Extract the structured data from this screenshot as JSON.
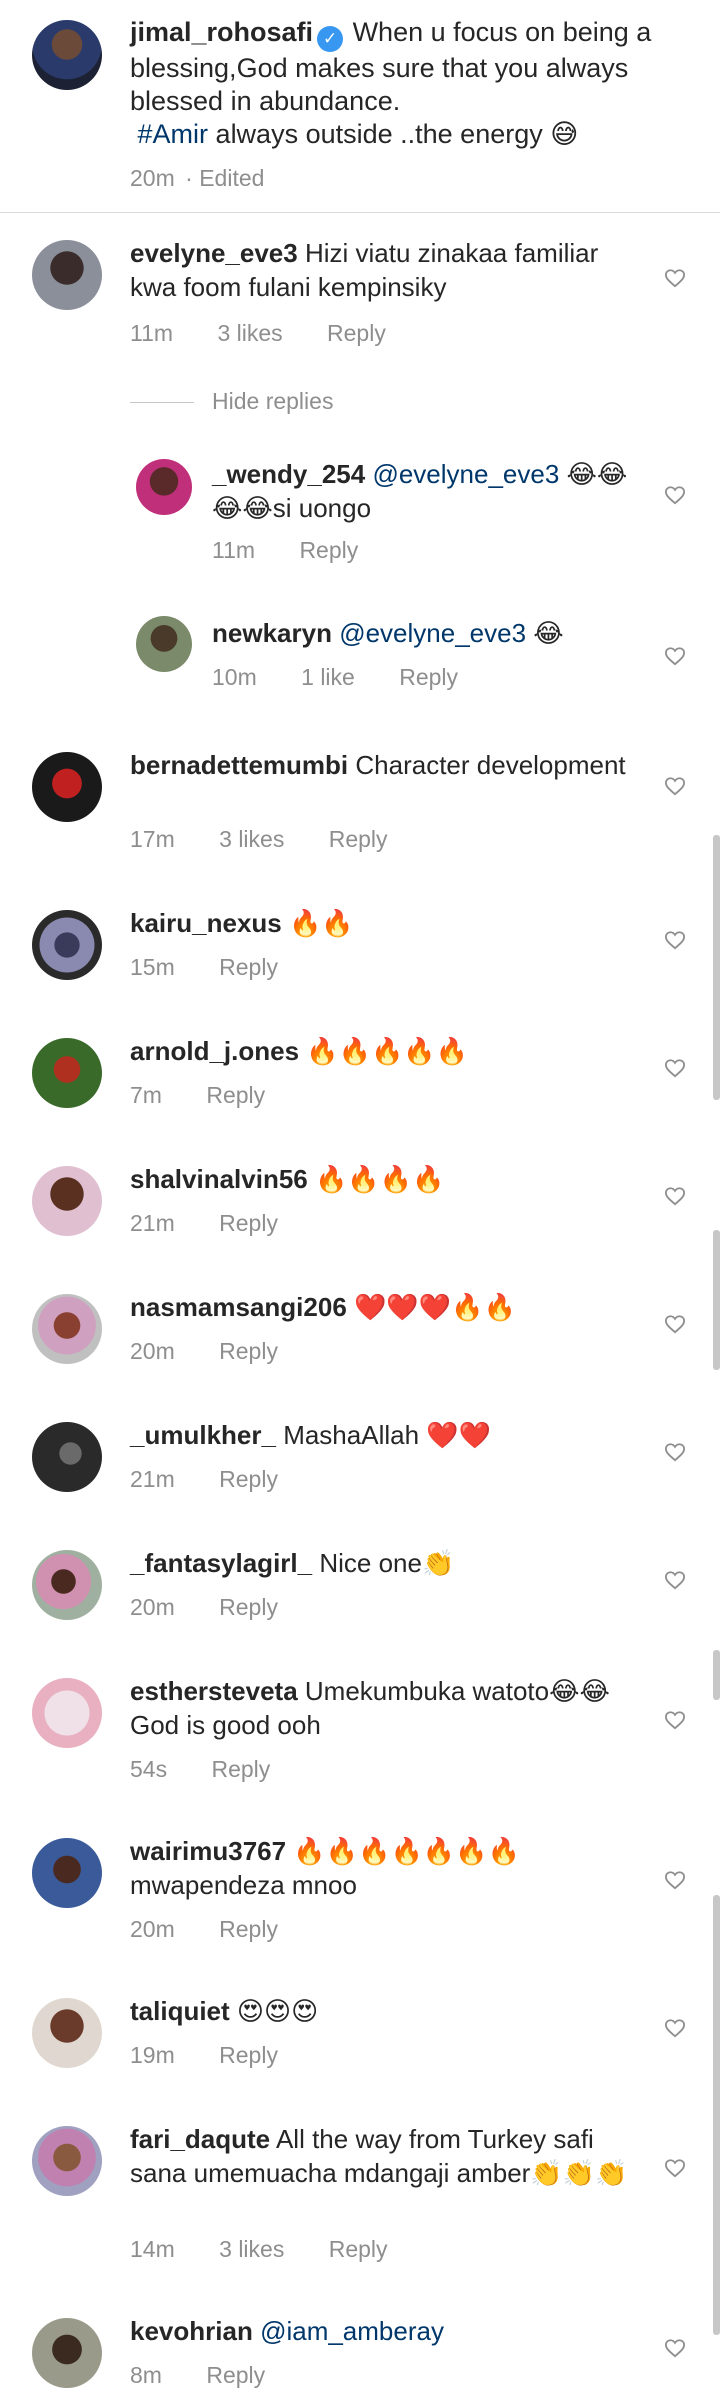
{
  "caption": {
    "username": "jimal_rohosafi",
    "text_part1": "When u focus on being a blessing,God makes sure that you always blessed in abundance.",
    "hashtag": "#Amir",
    "text_part2": "always outside ..the energy 😅",
    "time": "20m",
    "edited": "Edited"
  },
  "hide_replies_label": "Hide replies",
  "comments": [
    {
      "username": "evelyne_eve3",
      "text": "Hizi viatu zinakaa familiar kwa foom fulani kempinsiky",
      "time": "11m",
      "likes": "3 likes",
      "reply": "Reply"
    },
    {
      "username": "_wendy_254",
      "mention": "@evelyne_eve3",
      "text": "😂😂😂😂si uongo",
      "time": "11m",
      "likes": "",
      "reply": "Reply"
    },
    {
      "username": "newkaryn",
      "mention": "@evelyne_eve3",
      "text": "😂",
      "time": "10m",
      "likes": "1 like",
      "reply": "Reply"
    },
    {
      "username": "bernadettemumbi",
      "text": "Character development",
      "time": "17m",
      "likes": "3 likes",
      "reply": "Reply"
    },
    {
      "username": "kairu_nexus",
      "text": "🔥🔥",
      "time": "15m",
      "likes": "",
      "reply": "Reply"
    },
    {
      "username": "arnold_j.ones",
      "text": "🔥🔥🔥🔥🔥",
      "time": "7m",
      "likes": "",
      "reply": "Reply"
    },
    {
      "username": "shalvinalvin56",
      "text": "🔥🔥🔥🔥",
      "time": "21m",
      "likes": "",
      "reply": "Reply"
    },
    {
      "username": "nasmamsangi206",
      "text": "❤️❤️❤️🔥🔥",
      "time": "20m",
      "likes": "",
      "reply": "Reply"
    },
    {
      "username": "_umulkher_",
      "text": "MashaAllah ❤️❤️",
      "time": "21m",
      "likes": "",
      "reply": "Reply"
    },
    {
      "username": "_fantasylagirl_",
      "text": "Nice one👏",
      "time": "20m",
      "likes": "",
      "reply": "Reply"
    },
    {
      "username": "esthersteveta",
      "text": "Umekumbuka watoto😂😂God is good ooh",
      "time": "54s",
      "likes": "",
      "reply": "Reply"
    },
    {
      "username": "wairimu3767",
      "text": "🔥🔥🔥🔥🔥🔥🔥 mwapendeza mnoo",
      "time": "20m",
      "likes": "",
      "reply": "Reply"
    },
    {
      "username": "taliquiet",
      "text": "😍😍😍",
      "time": "19m",
      "likes": "",
      "reply": "Reply"
    },
    {
      "username": "fari_daqute",
      "text": "All the way from Turkey safi sana umemuacha mdangaji amber👏👏👏",
      "time": "14m",
      "likes": "3 likes",
      "reply": "Reply"
    },
    {
      "username": "kevohrian",
      "mention": "@iam_amberay",
      "text": "",
      "time": "8m",
      "likes": "",
      "reply": "Reply"
    }
  ],
  "icons": {
    "verified": "verified-badge-icon",
    "heart": "heart-outline-icon"
  },
  "colors": {
    "link": "#00376b",
    "meta": "#8e8e8e",
    "verified": "#3897f0",
    "divider": "#dbdbdb"
  }
}
